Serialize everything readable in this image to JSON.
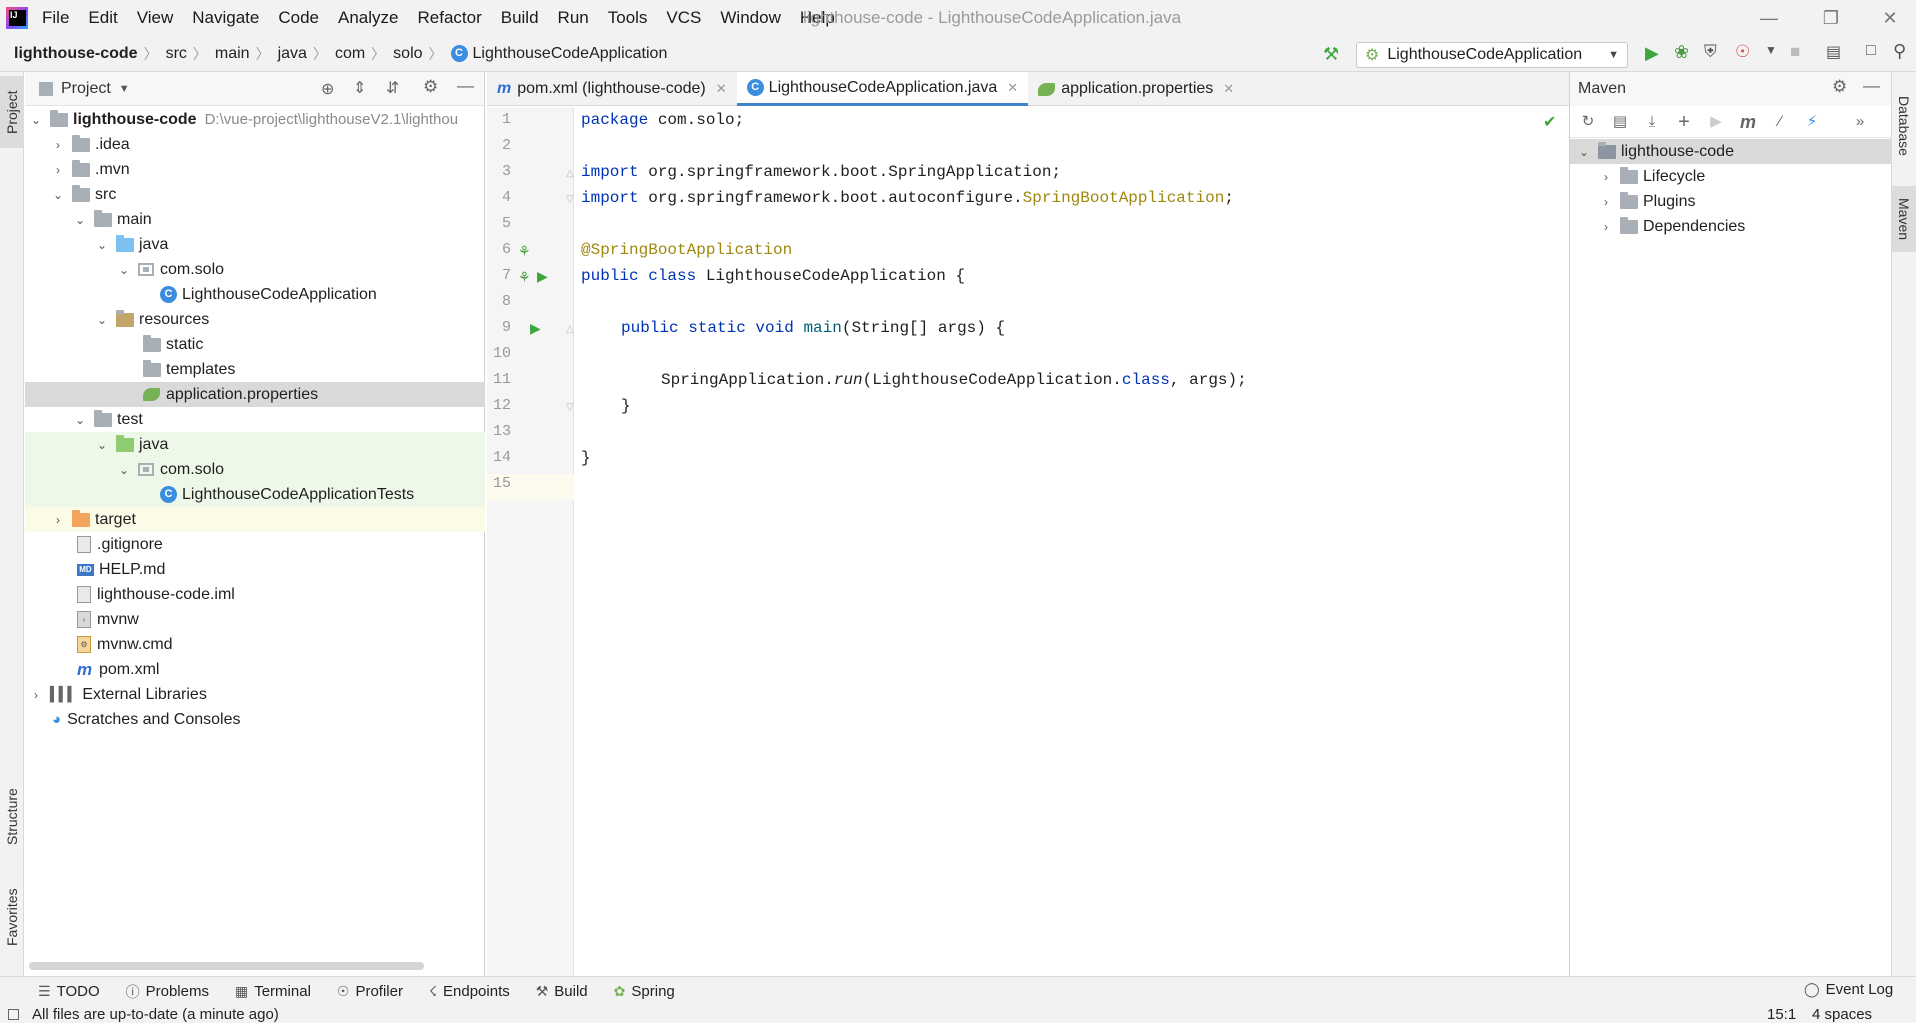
{
  "menu": [
    "File",
    "Edit",
    "View",
    "Navigate",
    "Code",
    "Analyze",
    "Refactor",
    "Build",
    "Run",
    "Tools",
    "VCS",
    "Window",
    "Help"
  ],
  "window_title": "lighthouse-code - LighthouseCodeApplication.java",
  "breadcrumbs": [
    "lighthouse-code",
    "src",
    "main",
    "java",
    "com",
    "solo",
    "LighthouseCodeApplication"
  ],
  "run_config": "LighthouseCodeApplication",
  "left_tabs": {
    "project": "Project",
    "structure": "Structure",
    "favorites": "Favorites"
  },
  "right_tabs": {
    "database": "Database",
    "maven": "Maven"
  },
  "project_panel": {
    "title": "Project"
  },
  "tree": [
    {
      "label": "lighthouse-code",
      "path": "D:\\vue-project\\lighthouseV2.1\\lighthou",
      "bold": true
    },
    {
      "label": ".idea"
    },
    {
      "label": ".mvn"
    },
    {
      "label": "src"
    },
    {
      "label": "main"
    },
    {
      "label": "java"
    },
    {
      "label": "com.solo"
    },
    {
      "label": "LighthouseCodeApplication"
    },
    {
      "label": "resources"
    },
    {
      "label": "static"
    },
    {
      "label": "templates"
    },
    {
      "label": "application.properties"
    },
    {
      "label": "test"
    },
    {
      "label": "java"
    },
    {
      "label": "com.solo"
    },
    {
      "label": "LighthouseCodeApplicationTests"
    },
    {
      "label": "target"
    },
    {
      "label": ".gitignore"
    },
    {
      "label": "HELP.md"
    },
    {
      "label": "lighthouse-code.iml"
    },
    {
      "label": "mvnw"
    },
    {
      "label": "mvnw.cmd"
    },
    {
      "label": "pom.xml"
    },
    {
      "label": "External Libraries"
    },
    {
      "label": "Scratches and Consoles"
    }
  ],
  "editor_tabs": [
    "pom.xml (lighthouse-code)",
    "LighthouseCodeApplication.java",
    "application.properties"
  ],
  "code": {
    "line_numbers": [
      "1",
      "2",
      "3",
      "4",
      "5",
      "6",
      "7",
      "8",
      "9",
      "10",
      "11",
      "12",
      "13",
      "14",
      "15"
    ],
    "l1_kw": "package",
    "l1_rest": " com.solo;",
    "l3_kw": "import",
    "l3_rest": " org.springframework.boot.SpringApplication;",
    "l4_kw": "import",
    "l4_rest": " org.springframework.boot.autoconfigure.",
    "l4_ann": "SpringBootApplication",
    "l4_end": ";",
    "l6_ann": "@SpringBootApplication",
    "l7_kw": "public class",
    "l7_rest": " LighthouseCodeApplication {",
    "l9_kw": "public static void",
    "l9_fn": "main",
    "l9_rest": "(String[] args) {",
    "l11_a": "SpringApplication.",
    "l11_run": "run",
    "l11_b": "(LighthouseCodeApplication.",
    "l11_kw": "class",
    "l11_c": ", args);",
    "l12": "}",
    "l14": "}"
  },
  "maven": {
    "title": "Maven",
    "root": "lighthouse-code",
    "items": [
      "Lifecycle",
      "Plugins",
      "Dependencies"
    ]
  },
  "bottom_tools": [
    "TODO",
    "Problems",
    "Terminal",
    "Profiler",
    "Endpoints",
    "Build",
    "Spring"
  ],
  "event_log": "Event Log",
  "status": {
    "message": "All files are up-to-date (a minute ago)",
    "position": "15:1",
    "indent": "4 spaces"
  },
  "colors": {
    "accent": "#4083c9",
    "keyword": "#0033b3",
    "annotation": "#9e880d",
    "run_green": "#3ea63e"
  }
}
